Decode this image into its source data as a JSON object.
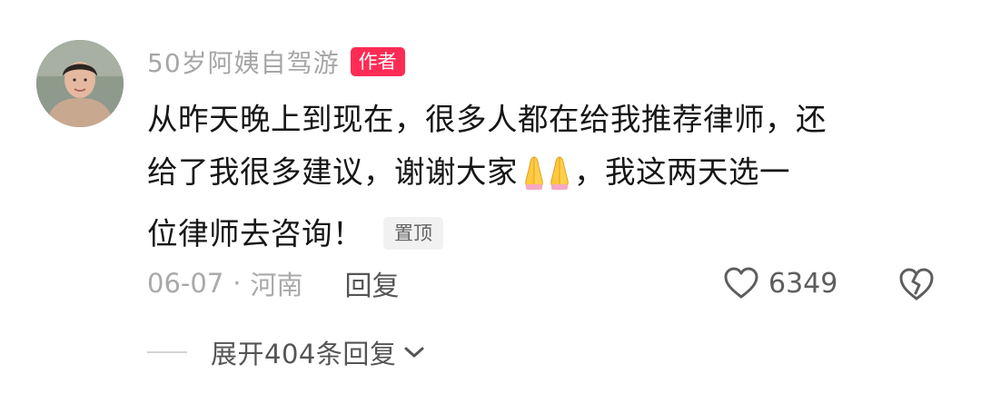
{
  "comment": {
    "author": {
      "name": "50岁阿姨自驾游",
      "badge": "作者"
    },
    "body": {
      "line1": "从昨天晚上到现在，很多人都在给我推荐律师，还",
      "line2a": "给了我很多建议，谢谢大家",
      "emoji": "🙏🙏",
      "line2b": "，我这两天选一",
      "line3": "位律师去咨询！",
      "pinned_badge": "置顶"
    },
    "meta": {
      "date": "06-07",
      "separator": "·",
      "location": "河南",
      "reply_label": "回复"
    },
    "actions": {
      "like_count": "6349",
      "like_icon": "heart-outline-icon",
      "dislike_icon": "broken-heart-icon"
    },
    "expand": {
      "label": "展开404条回复",
      "icon": "chevron-down-icon"
    },
    "colors": {
      "badge_red": "#fe2c55",
      "muted_text": "#a6a6a6",
      "body_text": "#161616"
    }
  }
}
